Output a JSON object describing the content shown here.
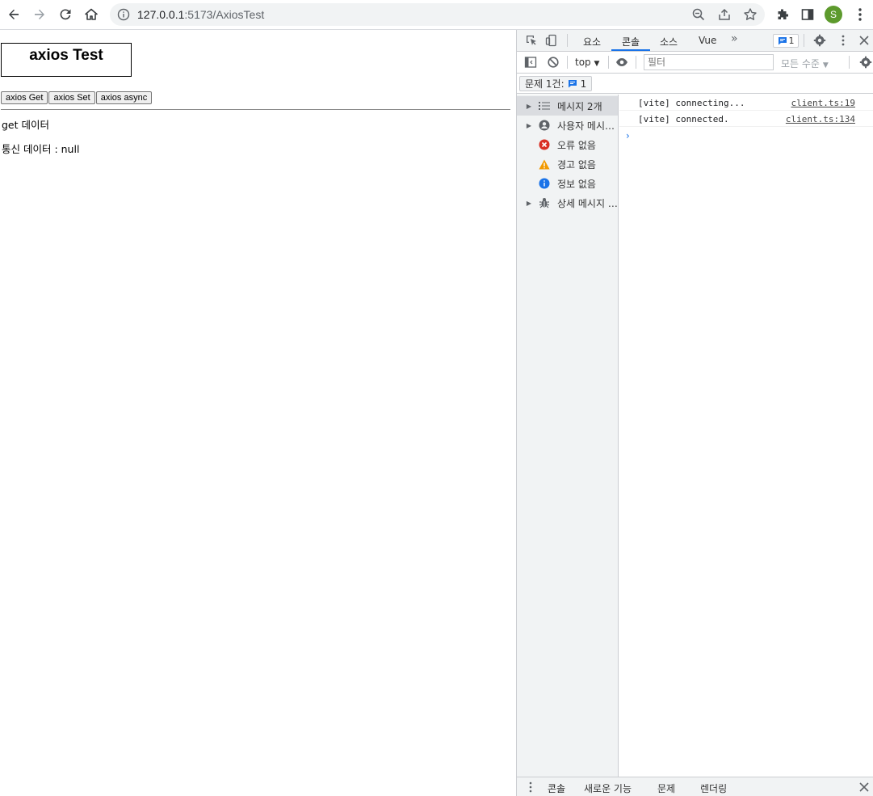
{
  "browser": {
    "url_host": "127.0.0.1",
    "url_rest": ":5173/AxiosTest",
    "avatar_letter": "S",
    "accent": "#1a73e8"
  },
  "page": {
    "title": "axios Test",
    "buttons": [
      "axios Get",
      "axios Set",
      "axios async"
    ],
    "get_label": "get 데이터",
    "comm_label": "통신 데이터 : null"
  },
  "devtools": {
    "tabs": [
      "요소",
      "콘솔",
      "소스",
      "Vue"
    ],
    "active_tab": "콘솔",
    "issue_count": "1",
    "context": "top",
    "filter_placeholder": "필터",
    "level": "모든 수준",
    "issues_label": "문제 1건:",
    "issues_count": "1",
    "sidebar": [
      {
        "label": "메시지 2개",
        "icon": "list-icon",
        "expandable": true
      },
      {
        "label": "사용자 메시지 없음",
        "icon": "user-icon",
        "expandable": true
      },
      {
        "label": "오류 없음",
        "icon": "error-icon",
        "expandable": false
      },
      {
        "label": "경고 없음",
        "icon": "warning-icon",
        "expandable": false
      },
      {
        "label": "정보 없음",
        "icon": "info-icon",
        "expandable": false
      },
      {
        "label": "상세 메시지 없음",
        "icon": "bug-icon",
        "expandable": true
      }
    ],
    "logs": [
      {
        "msg": "[vite] connecting...",
        "src": "client.ts:19"
      },
      {
        "msg": "[vite] connected.",
        "src": "client.ts:134"
      }
    ],
    "drawer_tabs": [
      "콘솔",
      "새로운 기능",
      "문제",
      "렌더링"
    ]
  }
}
